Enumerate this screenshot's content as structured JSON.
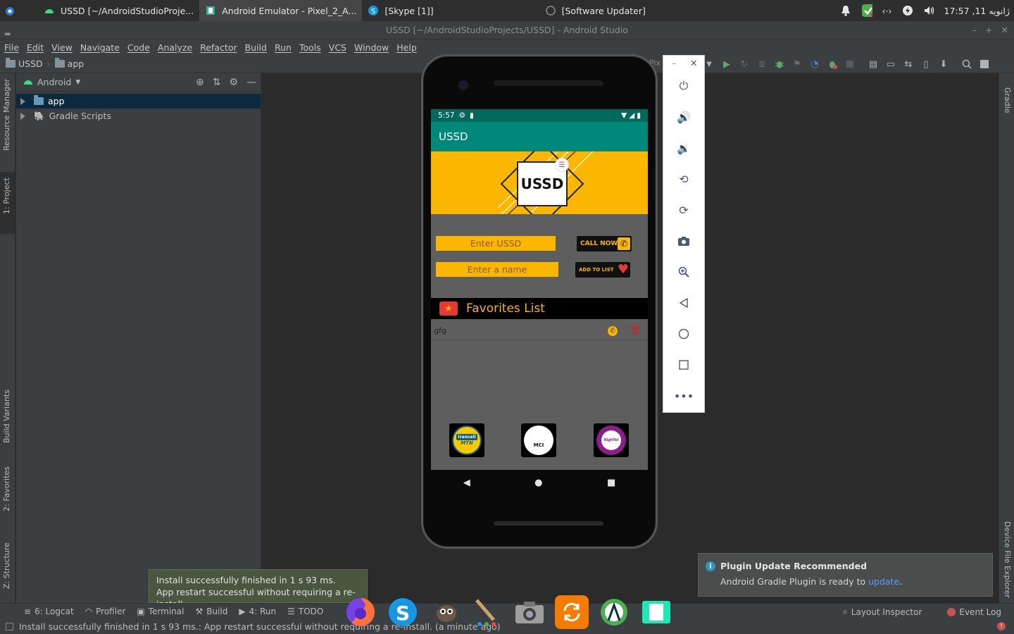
{
  "system": {
    "tasks": [
      {
        "label": "USSD [~/AndroidStudioProje...",
        "icon": "android-icon"
      },
      {
        "label": "Android Emulator - Pixel_2_A...",
        "icon": "emulator-icon"
      },
      {
        "label": "[Skype [1]]",
        "icon": "skype-icon"
      },
      {
        "label": "[Software Updater]",
        "icon": "updater-icon"
      }
    ],
    "clock": "17:57 ,11 ژانویه",
    "network": "‹·›"
  },
  "window": {
    "title": "USSD [~/AndroidStudioProjects/USSD] - Android Studio"
  },
  "menu": [
    "File",
    "Edit",
    "View",
    "Navigate",
    "Code",
    "Analyze",
    "Refactor",
    "Build",
    "Run",
    "Tools",
    "VCS",
    "Window",
    "Help"
  ],
  "breadcrumb": [
    "USSD",
    "app"
  ],
  "device_combo": "Pix",
  "left_tabs": [
    "Resource Manager",
    "1: Project",
    "Build Variants",
    "2: Favorites",
    "Z: Structure"
  ],
  "right_tabs": [
    "Gradle",
    "Device File Explorer"
  ],
  "project": {
    "view": "Android",
    "items": [
      {
        "label": "app"
      },
      {
        "label": "Gradle Scripts"
      }
    ]
  },
  "phone": {
    "time": "5:57",
    "app_title": "USSD",
    "logo_text": "USSD",
    "ussd_placeholder": "Enter USSD",
    "name_placeholder": "Enter a name",
    "call_button": "CALL NOW",
    "add_button": "ADD TO LIST",
    "favorites_title": "Favorites List",
    "favorite_item": "gfg",
    "operators": [
      "Irancell MTN",
      "MCI",
      "RighTel"
    ],
    "operator_labels": [
      "Irancell",
      "MTN",
      "MCI",
      "RighTel"
    ]
  },
  "notification": {
    "title": "Plugin Update Recommended",
    "body": "Android Gradle Plugin is ready to ",
    "link": "update",
    "tail": "."
  },
  "tooltip": {
    "line1": "Install successfully finished in 1 s 93 ms.",
    "line2": "App restart successful without requiring a re-install."
  },
  "bottom_tabs": [
    {
      "label": "6: Logcat"
    },
    {
      "label": "Profiler"
    },
    {
      "label": "Terminal"
    },
    {
      "label": "Build"
    },
    {
      "label": "4: Run"
    },
    {
      "label": "TODO"
    }
  ],
  "bottom_right": [
    "Layout Inspector",
    "Event Log"
  ],
  "status_message": "Install successfully finished in 1 s 93 ms.: App restart successful without requiring a re-install. (a minute ago)",
  "colors": {
    "accent_teal": "#00897b",
    "accent_yellow": "#fbb600"
  }
}
